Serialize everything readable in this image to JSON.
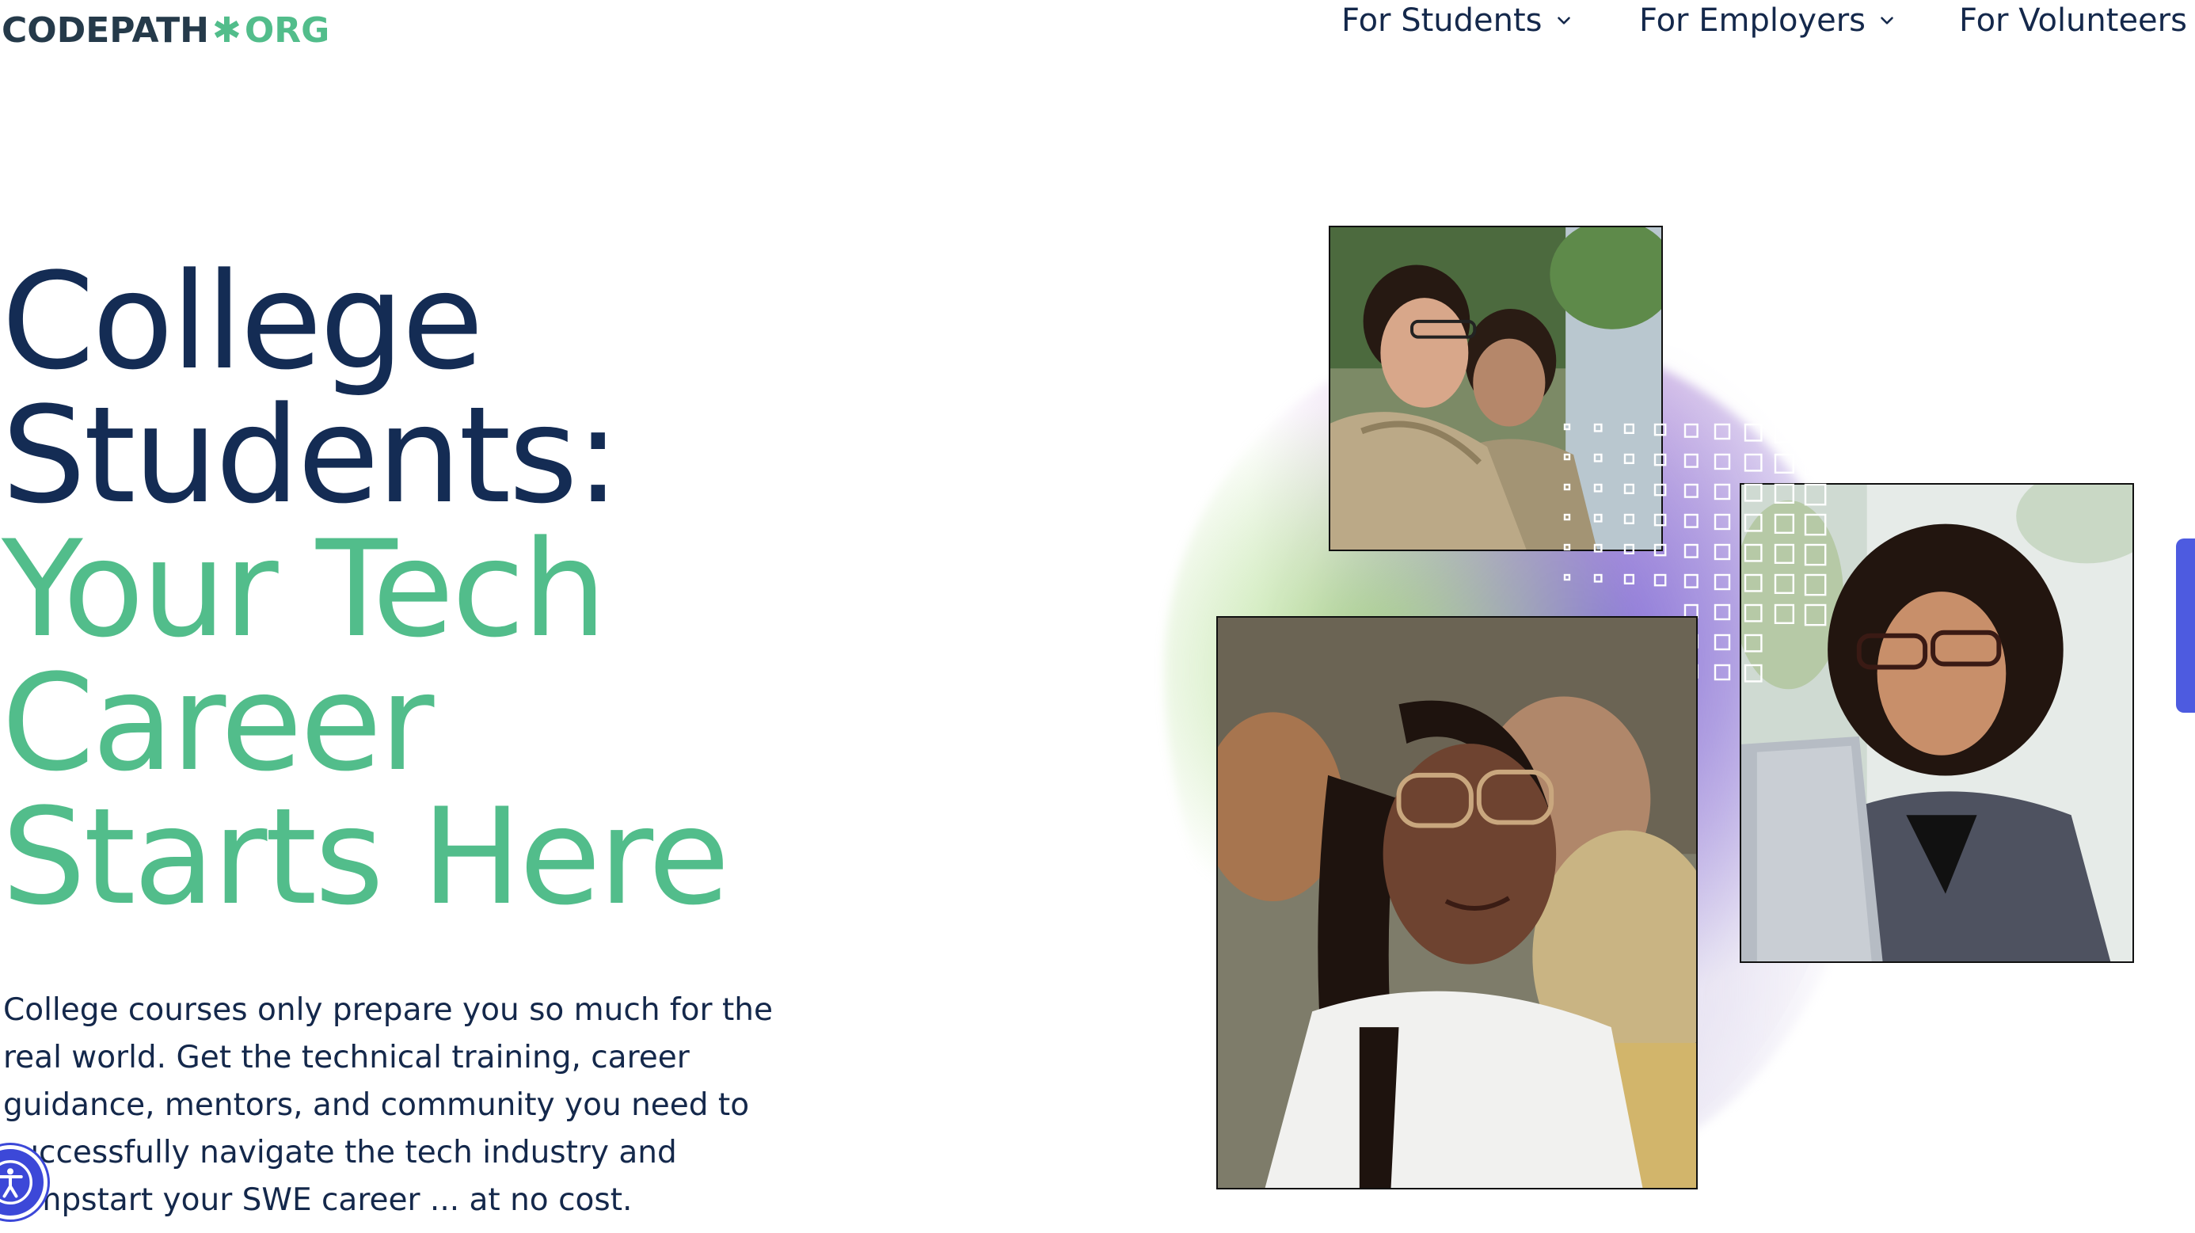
{
  "header": {
    "logo": {
      "main": "CODEPATH",
      "star": "✱",
      "org": "ORG"
    },
    "nav": [
      {
        "label": "For Students",
        "icon": "chevron-down-icon"
      },
      {
        "label": "For Employers",
        "icon": "chevron-down-icon"
      },
      {
        "label": "For Volunteers"
      }
    ]
  },
  "hero": {
    "headline_dark": [
      "College",
      "Students:"
    ],
    "headline_green": [
      "Your Tech",
      "Career",
      "Starts Here"
    ],
    "description": "College courses only prepare you so much for the real world. Get the technical training, career guidance, mentors, and community you need to successfully navigate the tech industry and jumpstart your SWE career ... at no cost."
  },
  "images": [
    {
      "alt": "Two students in tan hoodies working at laptops"
    },
    {
      "alt": "Student with curly hair and glasses typing on a laptop"
    },
    {
      "alt": "Smiling student with braids and glasses in a classroom"
    }
  ],
  "accessibility": {
    "icon": "accessibility-icon"
  },
  "colors": {
    "navy": "#142c54",
    "green": "#52bd8b",
    "accent_blue": "#3c48d8"
  }
}
